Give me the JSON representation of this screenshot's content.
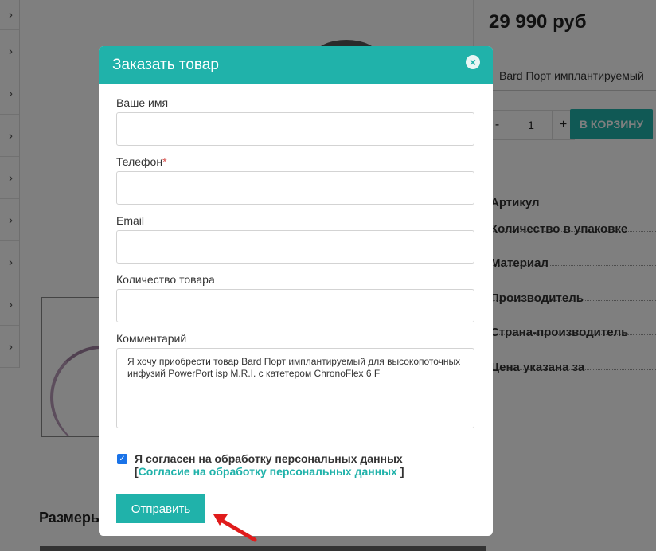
{
  "page": {
    "price": "29 990 руб",
    "variant_select": "Bard Порт имплантируемый",
    "quantity": "1",
    "qty_minus": "-",
    "qty_plus": "+",
    "cart_button": "В КОРЗИНУ",
    "properties": [
      "Артикул",
      "Количество в упаковке",
      "Материал",
      "Производитель",
      "Страна-производитель",
      "Цена указана за"
    ],
    "sizes_heading": "Размеры",
    "sidebar_chevron": "›"
  },
  "modal": {
    "title": "Заказать товар",
    "close_icon": "×",
    "fields": {
      "name_label": "Ваше имя",
      "phone_label": "Телефон",
      "required_mark": "*",
      "email_label": "Email",
      "quantity_label": "Количество товара",
      "comment_label": "Комментарий",
      "comment_value": "Я хочу приобрести товар Bard Порт имплантируемый для высокопоточных инфузий PowerPort isp M.R.I. с катетером ChronoFlex 6 F"
    },
    "consent": {
      "checked": true,
      "checkmark": "✓",
      "text": "Я согласен на обработку персональных данных",
      "bracket_open": "[",
      "link": "Согласие на обработку персональных данных",
      "bracket_close": "]"
    },
    "submit_label": "Отправить"
  },
  "colors": {
    "accent": "#20b2aa",
    "arrow": "#e01b1b",
    "checkbox": "#1a73e8"
  }
}
